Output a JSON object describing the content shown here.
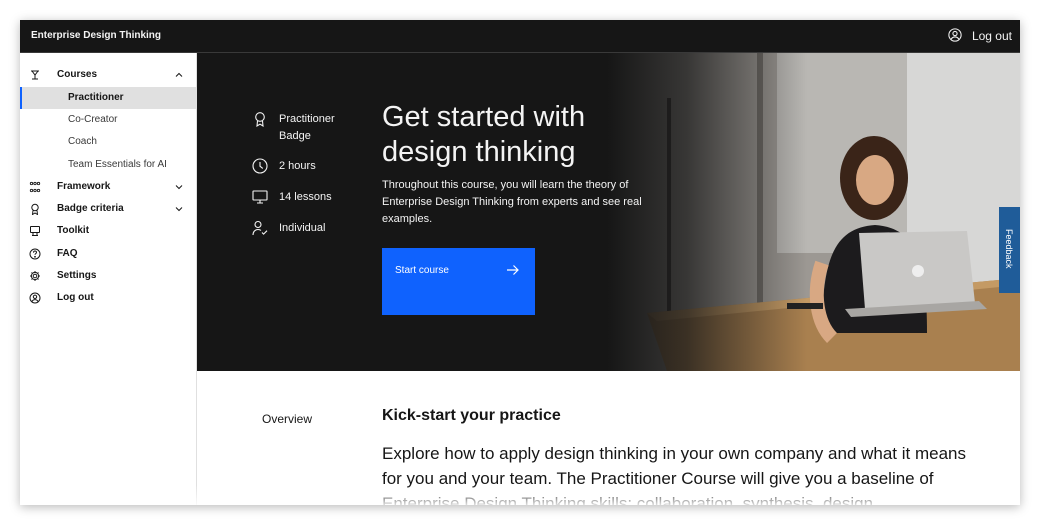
{
  "header": {
    "brand": "Enterprise Design Thinking",
    "logout_label": "Log out"
  },
  "sidebar": {
    "items": [
      {
        "label": "Courses",
        "icon": "courses-icon",
        "expanded": true
      },
      {
        "label": "Framework",
        "icon": "framework-icon",
        "expanded": false
      },
      {
        "label": "Badge criteria",
        "icon": "badge-icon",
        "expanded": false
      },
      {
        "label": "Toolkit",
        "icon": "toolkit-icon"
      },
      {
        "label": "FAQ",
        "icon": "help-icon"
      },
      {
        "label": "Settings",
        "icon": "settings-icon"
      },
      {
        "label": "Log out",
        "icon": "user-avatar-icon"
      }
    ],
    "course_subitems": [
      {
        "label": "Practitioner",
        "active": true
      },
      {
        "label": "Co-Creator",
        "active": false
      },
      {
        "label": "Coach",
        "active": false
      },
      {
        "label": "Team Essentials for AI",
        "active": false
      }
    ]
  },
  "hero": {
    "stats": [
      {
        "icon": "badge-icon",
        "label": "Practitioner Badge"
      },
      {
        "icon": "clock-icon",
        "label": "2 hours"
      },
      {
        "icon": "screen-icon",
        "label": "14 lessons"
      },
      {
        "icon": "user-icon",
        "label": "Individual"
      }
    ],
    "title": "Get started with design thinking",
    "description": "Throughout this course, you will learn the theory of Enterprise Design Thinking from experts and see real examples.",
    "cta_label": "Start course"
  },
  "feedback_label": "Feedback",
  "content": {
    "section_label": "Overview",
    "heading": "Kick-start your practice",
    "body": "Explore how to apply design thinking in your own company and what it means for you and your team. The Practitioner Course will give you a baseline of Enterprise Design Thinking skills: collaboration, synthesis, design"
  },
  "colors": {
    "header_bg": "#161616",
    "hero_bg": "#161616",
    "accent_blue": "#0f62fe",
    "feedback_bg": "#1f5c99",
    "active_nav_bg": "#e0e0e0"
  }
}
